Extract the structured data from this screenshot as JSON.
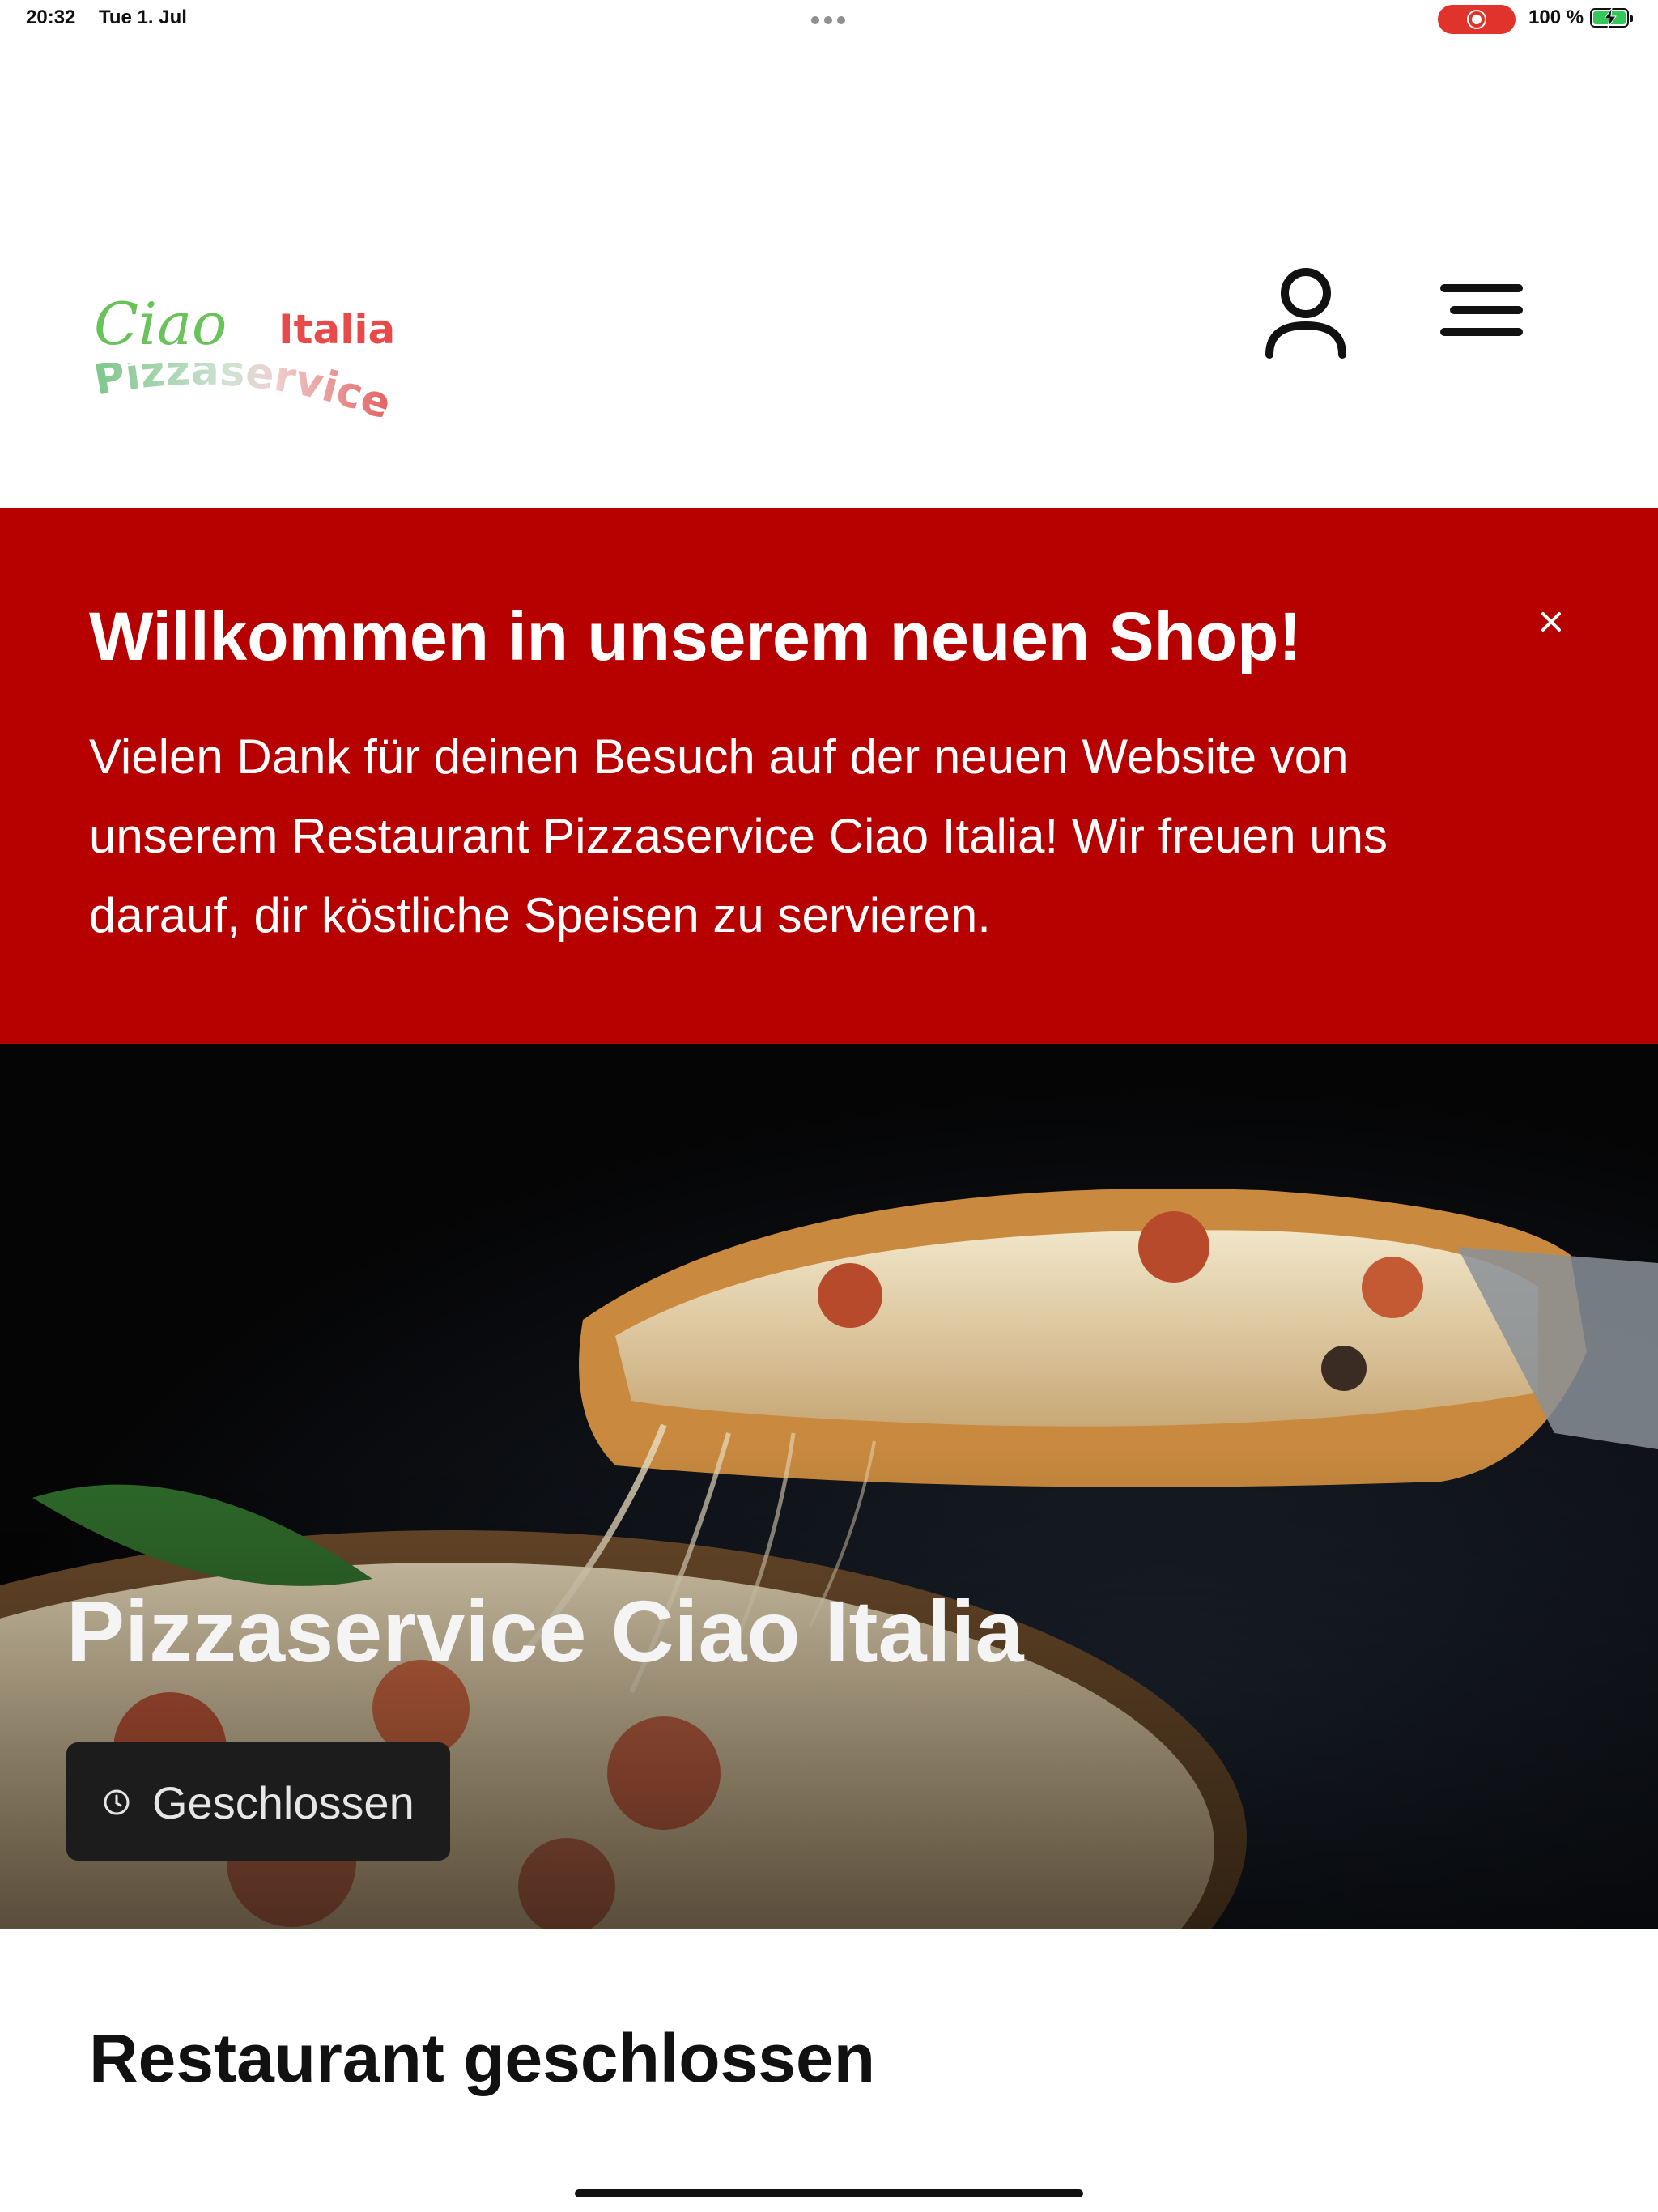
{
  "status_bar": {
    "time": "20:32",
    "date": "Tue 1. Jul",
    "battery": "100 %"
  },
  "header": {
    "logo": {
      "word1": "Ciao",
      "word2": "Italia",
      "word3": "Pizzaservice"
    },
    "user_icon": "person-icon",
    "menu_icon": "hamburger-menu-icon"
  },
  "announcement": {
    "title": "Willkommen in unserem neuen Shop!",
    "body": "Vielen Dank für deinen Besuch auf der neuen Website von unserem Restaurant Pizzaservice Ciao Italia! Wir freuen uns darauf, dir köstliche Speisen zu servieren.",
    "background": "#b70000",
    "close_icon": "close-icon"
  },
  "hero": {
    "title": "Pizzaservice Ciao Italia",
    "status": "Geschlossen",
    "status_icon": "clock-icon"
  },
  "closed_section": {
    "title": "Restaurant geschlossen"
  }
}
